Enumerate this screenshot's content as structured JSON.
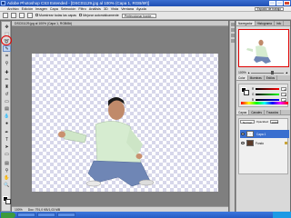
{
  "window": {
    "title": "Adobe Photoshop CS3 Extended - [DSC01129.jpg al 100% (Capa 1, RGB/8#)]"
  },
  "menu": [
    "Archivo",
    "Edición",
    "Imagen",
    "Capa",
    "Selección",
    "Filtro",
    "Análisis",
    "3D",
    "Vista",
    "Ventana",
    "Ayuda"
  ],
  "workspace": "Espacio de trabajo",
  "options": {
    "sample_all": "Muestrear todas las capas",
    "auto_enhance": "Mejorar automáticamente",
    "refine": "Perfeccionar borde..."
  },
  "document": {
    "tab": "DSC01129.jpg al 100% (Capa 1, RGB/8#)",
    "zoom_status": "100%",
    "doc_info": "Doc: 791,0 KB/1,03 MB"
  },
  "navigator": {
    "tabs": [
      "Navegador",
      "Histograma",
      "Info"
    ],
    "zoom": "100%"
  },
  "color_panel": {
    "tabs": [
      "Color",
      "Muestras",
      "Estilos"
    ],
    "rows": [
      {
        "label": "R",
        "value": "0"
      },
      {
        "label": "G",
        "value": "0"
      },
      {
        "label": "B",
        "value": "0"
      }
    ]
  },
  "layers_panel": {
    "tabs": [
      "Capas",
      "Canales",
      "Trazados"
    ],
    "blend": "Normal",
    "opacity_label": "Opacidad:",
    "opacity": "100%",
    "layers": [
      {
        "name": "Capa 1",
        "selected": true
      },
      {
        "name": "Fondo",
        "selected": false
      }
    ]
  }
}
